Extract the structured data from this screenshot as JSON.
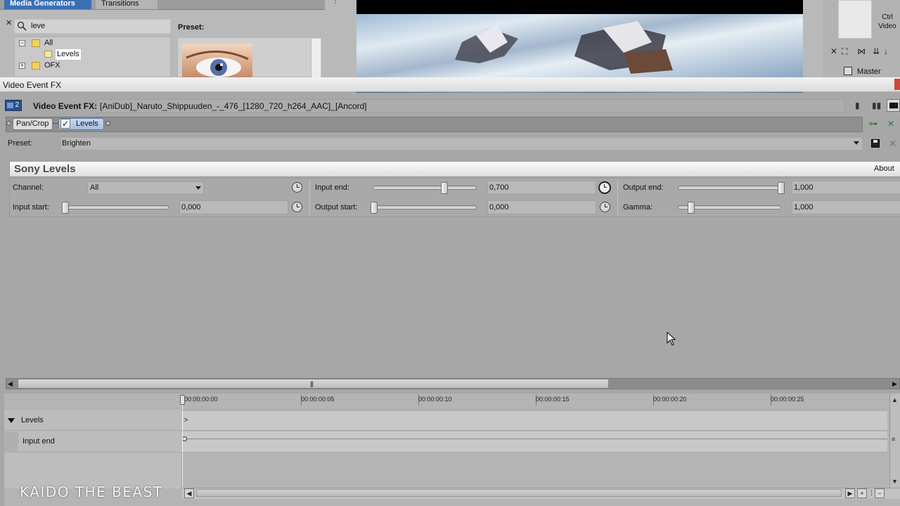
{
  "media_generators": {
    "tabs": [
      {
        "label": "Media Generators"
      },
      {
        "label": "Transitions"
      }
    ],
    "search_value": "leve",
    "tree": [
      {
        "label": "All"
      },
      {
        "label": "Levels"
      },
      {
        "label": "OFX"
      }
    ],
    "preset_label": "Preset:"
  },
  "right_panel": {
    "ctrl_label": "Ctrl",
    "video_label": "Video",
    "master_label": "Master"
  },
  "window": {
    "title": "Video Event FX"
  },
  "fx_header": {
    "label": "Video Event FX:",
    "file_name": "[AniDub]_Naruto_Shippuuden_-_476_[1280_720_h264_AAC]_[Ancord]",
    "badge": "2"
  },
  "fx_chain": [
    {
      "label": "Pan/Crop"
    },
    {
      "label": "Levels"
    }
  ],
  "preset": {
    "label": "Preset:",
    "value": "Brighten"
  },
  "plugin": {
    "title": "Sony Levels",
    "about": "About",
    "params": {
      "channel": {
        "label": "Channel:",
        "value": "All"
      },
      "input_start": {
        "label": "Input start:",
        "value": "0,000",
        "level": 0.0
      },
      "input_end": {
        "label": "Input end:",
        "value": "0,700",
        "level": 0.7
      },
      "output_start": {
        "label": "Output start:",
        "value": "0,000",
        "level": 0.0
      },
      "output_end": {
        "label": "Output end:",
        "value": "1,000",
        "level": 1.0
      },
      "gamma": {
        "label": "Gamma:",
        "value": "1,000",
        "level": 0.1
      }
    }
  },
  "timeline": {
    "ticks": [
      "00:00:00:00",
      "00:00:00:05",
      "00:00:00:10",
      "00:00:00:15",
      "00:00:00:20",
      "00:00:00:25"
    ],
    "rows": [
      {
        "label": "Levels"
      },
      {
        "label": "Input end"
      }
    ]
  },
  "watermark": "KAIDO THE BEAST"
}
